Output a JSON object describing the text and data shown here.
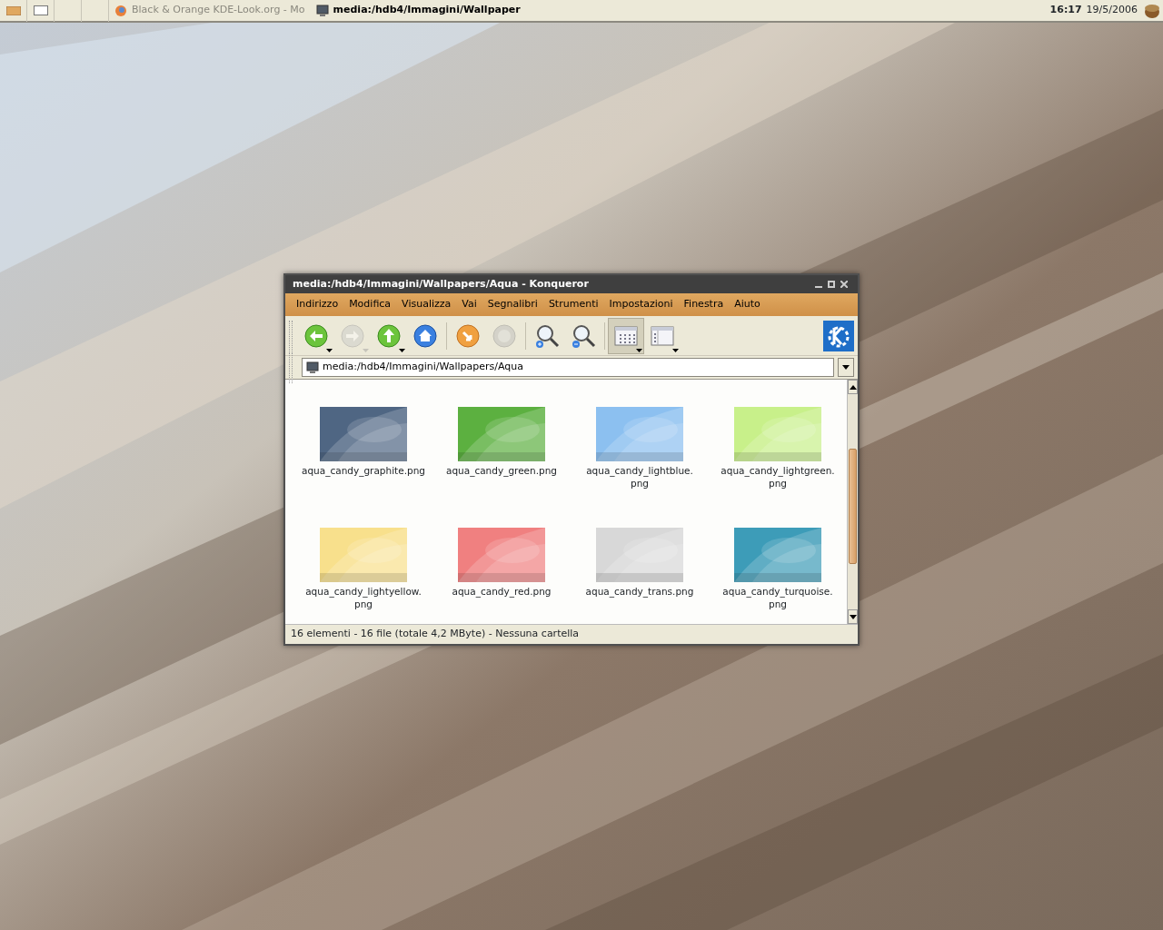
{
  "taskbar": {
    "tasks": [
      {
        "label": "Black & Orange KDE-Look.org - Mo",
        "selected": false
      },
      {
        "label": "media:/hdb4/Immagini/Wallpaper",
        "selected": true
      }
    ],
    "clock": {
      "time": "16:17",
      "date": "19/5/2006"
    }
  },
  "window": {
    "title": "media:/hdb4/Immagini/Wallpapers/Aqua - Konqueror",
    "menu": [
      "Indirizzo",
      "Modifica",
      "Visualizza",
      "Vai",
      "Segnalibri",
      "Strumenti",
      "Impostazioni",
      "Finestra",
      "Aiuto"
    ],
    "toolbar": [
      {
        "kind": "back",
        "disabled": false,
        "selected": false,
        "dropdown": true
      },
      {
        "kind": "forward",
        "disabled": true,
        "selected": false,
        "dropdown": true
      },
      {
        "kind": "up",
        "disabled": false,
        "selected": false,
        "dropdown": true
      },
      {
        "kind": "home",
        "disabled": false,
        "selected": false,
        "dropdown": false
      },
      {
        "kind": "separator"
      },
      {
        "kind": "reload",
        "disabled": false,
        "selected": false,
        "dropdown": false
      },
      {
        "kind": "stop",
        "disabled": true,
        "selected": false,
        "dropdown": false
      },
      {
        "kind": "separator"
      },
      {
        "kind": "zoom-in",
        "disabled": false,
        "selected": false,
        "dropdown": false
      },
      {
        "kind": "zoom-out",
        "disabled": false,
        "selected": false,
        "dropdown": false
      },
      {
        "kind": "separator"
      },
      {
        "kind": "icon-view",
        "disabled": false,
        "selected": true,
        "dropdown": true
      },
      {
        "kind": "detail-view",
        "disabled": false,
        "selected": false,
        "dropdown": true
      }
    ],
    "location": "media:/hdb4/Immagini/Wallpapers/Aqua",
    "files": [
      {
        "name": "aqua_candy_graphite.png",
        "color": "#4f6683"
      },
      {
        "name": "aqua_candy_green.png",
        "color": "#5cb040"
      },
      {
        "name": "aqua_candy_lightblue.png",
        "color": "#8cc0f0"
      },
      {
        "name": "aqua_candy_lightgreen.png",
        "color": "#c8f08a"
      },
      {
        "name": "aqua_candy_lightyellow.png",
        "color": "#f8e08c"
      },
      {
        "name": "aqua_candy_red.png",
        "color": "#f08080"
      },
      {
        "name": "aqua_candy_trans.png",
        "color": "#d8d8d8"
      },
      {
        "name": "aqua_candy_turquoise.png",
        "color": "#3d9cb8"
      }
    ],
    "status": "16 elementi - 16 file (totale 4,2 MByte) - Nessuna cartella"
  }
}
